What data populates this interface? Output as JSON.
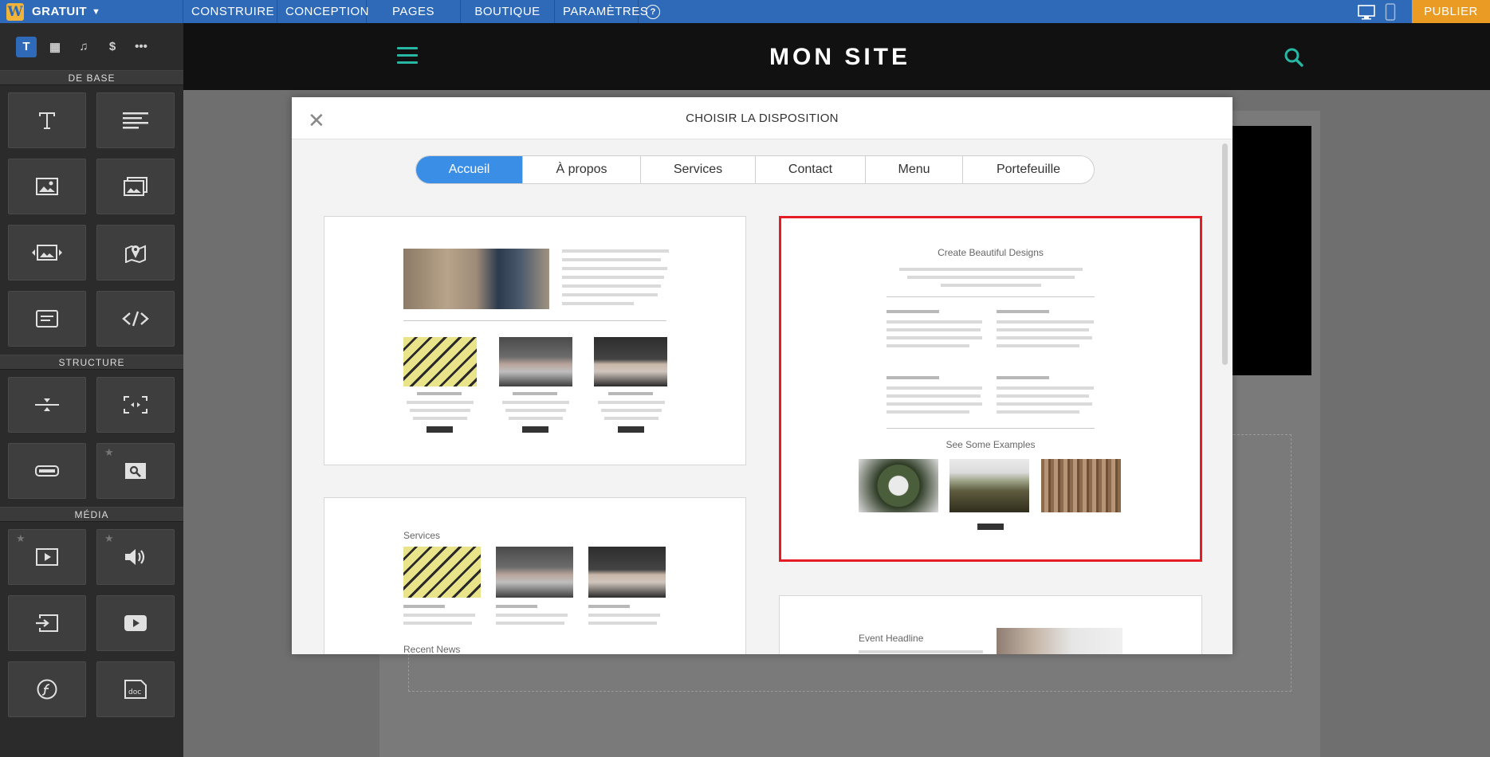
{
  "topbar": {
    "logo": "W",
    "plan": "GRATUIT",
    "nav": [
      "CONSTRUIRE",
      "CONCEPTION",
      "PAGES",
      "BOUTIQUE",
      "PARAMÈTRES"
    ],
    "help": "?",
    "publish": "PUBLIER",
    "colors": {
      "bar": "#2e6ab8",
      "publish": "#e99b23"
    }
  },
  "sidebar": {
    "tabs": [
      {
        "icon": "text-tab-icon",
        "glyph": "T",
        "active": true
      },
      {
        "icon": "layout-tab-icon",
        "glyph": "▦",
        "active": false
      },
      {
        "icon": "music-tab-icon",
        "glyph": "♫",
        "active": false
      },
      {
        "icon": "commerce-tab-icon",
        "glyph": "$",
        "active": false
      },
      {
        "icon": "more-tab-icon",
        "glyph": "•••",
        "active": false
      }
    ],
    "sections": {
      "basic": "DE BASE",
      "structure": "STRUCTURE",
      "media": "MÉDIA"
    }
  },
  "site": {
    "title": "MON SITE",
    "accent": "#27b7a4"
  },
  "modal": {
    "title": "CHOISIR LA DISPOSITION",
    "layouts": [
      "Accueil",
      "À propos",
      "Services",
      "Contact",
      "Menu",
      "Portefeuille"
    ],
    "active_layout": "Accueil",
    "cards": {
      "right_top": {
        "heading": "Create Beautiful Designs",
        "subheading": "See Some Examples"
      },
      "left_bottom": {
        "heading": "Services",
        "subheading": "Recent News"
      },
      "right_bottom": {
        "heading": "Event Headline"
      }
    },
    "selected_border": "#e51c24"
  }
}
